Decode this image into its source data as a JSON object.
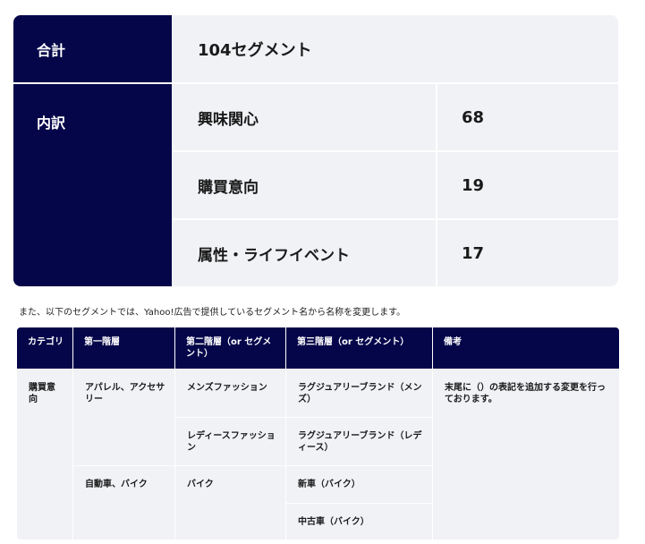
{
  "summary": {
    "total_label": "合計",
    "total_value": "104セグメント",
    "breakdown_label": "内訳",
    "rows": [
      {
        "label": "興味関心",
        "value": "68"
      },
      {
        "label": "購買意向",
        "value": "19"
      },
      {
        "label": "属性・ライフイベント",
        "value": "17"
      }
    ]
  },
  "note": "また、以下のセグメントでは、Yahoo!広告で提供しているセグメント名から名称を変更します。",
  "table": {
    "headers": [
      "カテゴリ",
      "第一階層",
      "第二階層（or セグメント）",
      "第三階層（or セグメント）",
      "備考"
    ],
    "category": "購買意向",
    "remark": "末尾に（）の表記を追加する変更を行っております。",
    "level1": [
      "アパレル、アクセサリー",
      "自動車、バイク"
    ],
    "level2": [
      "メンズファッション",
      "レディースファッション",
      "バイク"
    ],
    "level3": [
      "ラグジュアリーブランド（メンズ）",
      "ラグジュアリーブランド（レディース）",
      "新車（バイク）",
      "中古車（バイク）"
    ]
  }
}
